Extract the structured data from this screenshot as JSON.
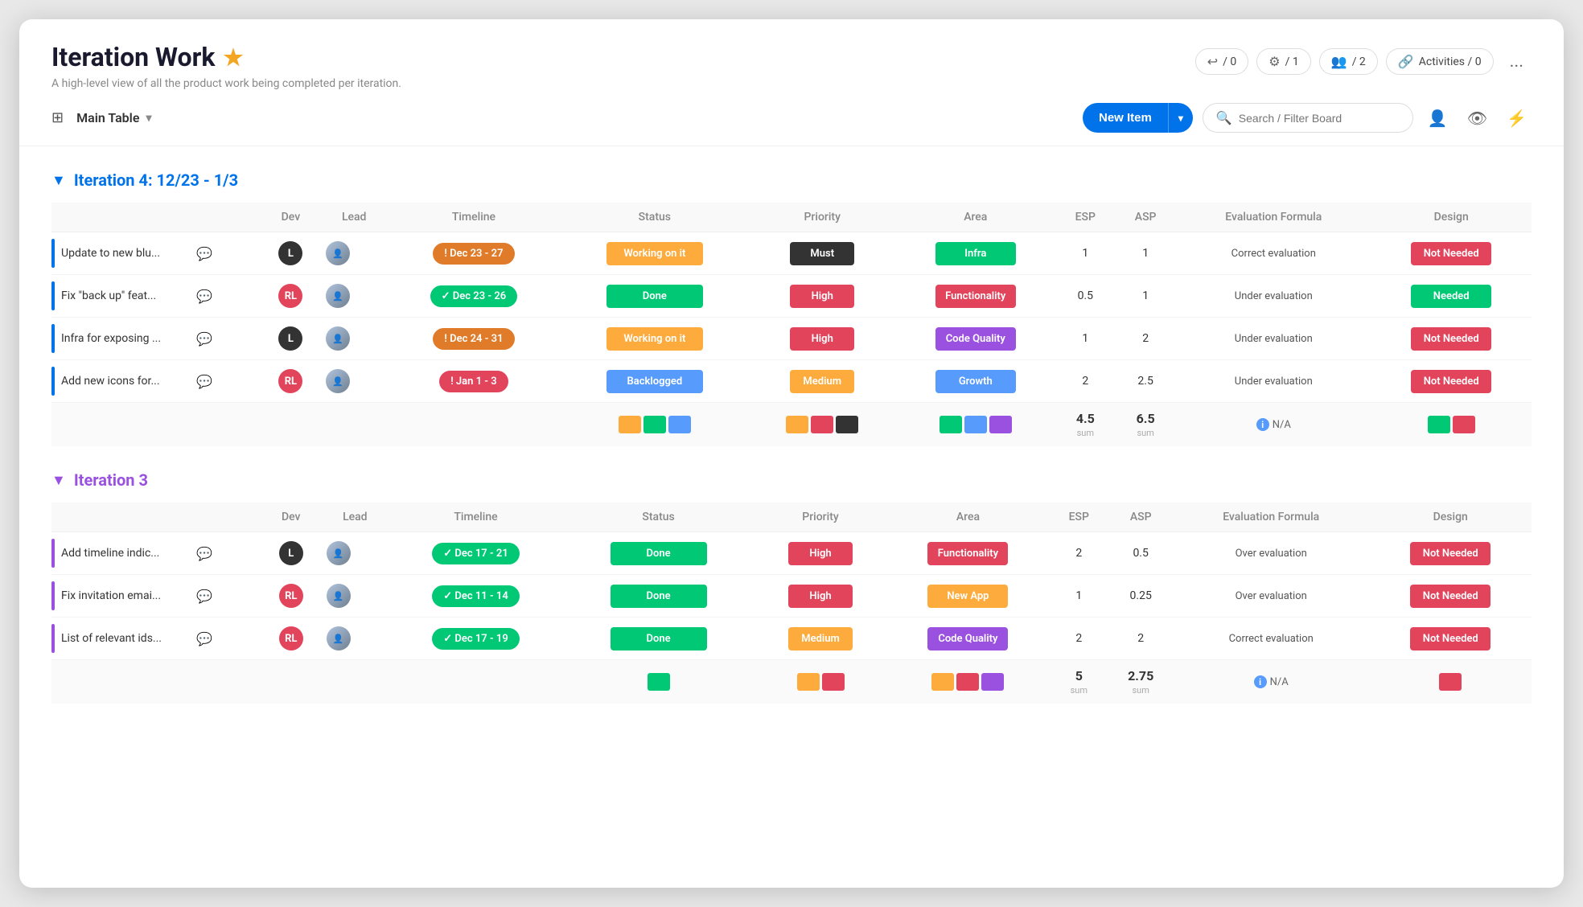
{
  "header": {
    "title": "Iteration Work",
    "subtitle": "A high-level view of all the product work being completed per iteration.",
    "badges": [
      {
        "icon": "🔁",
        "count": "/ 0"
      },
      {
        "icon": "🔗",
        "count": "/ 1"
      },
      {
        "icon": "👥",
        "count": "/ 2"
      }
    ],
    "activities": "Activities / 0",
    "more": "..."
  },
  "toolbar": {
    "main_table": "Main Table",
    "new_item": "New Item",
    "search_placeholder": "Search / Filter Board"
  },
  "iteration4": {
    "title": "Iteration 4: 12/23 - 1/3",
    "columns": [
      "Dev",
      "Lead",
      "Timeline",
      "Status",
      "Priority",
      "Area",
      "ESP",
      "ASP",
      "Evaluation Formula",
      "Design"
    ],
    "rows": [
      {
        "name": "Update to new blu...",
        "bar_color": "#0073ea",
        "dev_label": "L",
        "dev_bg": "#333",
        "timeline": "! Dec 23 - 27",
        "timeline_class": "timeline-orange",
        "status": "Working on it",
        "status_class": "status-working",
        "priority": "Must",
        "priority_class": "priority-must",
        "area": "Infra",
        "area_class": "area-infra",
        "esp": "1",
        "asp": "1",
        "eval": "Correct evaluation",
        "design": "Not Needed",
        "design_class": "design-not-needed"
      },
      {
        "name": "Fix \"back up\" feat...",
        "bar_color": "#0073ea",
        "dev_label": "RL",
        "dev_bg": "#e2445c",
        "timeline": "✓ Dec 23 - 26",
        "timeline_class": "timeline-green",
        "status": "Done",
        "status_class": "status-done",
        "priority": "High",
        "priority_class": "priority-high",
        "area": "Functionality",
        "area_class": "area-functionality",
        "esp": "0.5",
        "asp": "1",
        "eval": "Under evaluation",
        "design": "Needed",
        "design_class": "design-needed"
      },
      {
        "name": "Infra for exposing ...",
        "bar_color": "#0073ea",
        "dev_label": "L",
        "dev_bg": "#333",
        "timeline": "! Dec 24 - 31",
        "timeline_class": "timeline-orange",
        "status": "Working on it",
        "status_class": "status-working",
        "priority": "High",
        "priority_class": "priority-high",
        "area": "Code Quality",
        "area_class": "area-code",
        "esp": "1",
        "asp": "2",
        "eval": "Under evaluation",
        "design": "Not Needed",
        "design_class": "design-not-needed"
      },
      {
        "name": "Add new icons for...",
        "bar_color": "#0073ea",
        "dev_label": "RL",
        "dev_bg": "#e2445c",
        "timeline": "! Jan 1 - 3",
        "timeline_class": "timeline-red",
        "status": "Backlogged",
        "status_class": "status-backlogged",
        "priority": "Medium",
        "priority_class": "priority-medium",
        "area": "Growth",
        "area_class": "area-growth",
        "esp": "2",
        "asp": "2.5",
        "eval": "Under evaluation",
        "design": "Not Needed",
        "design_class": "design-not-needed"
      }
    ],
    "sum": {
      "esp": "4.5",
      "asp": "6.5",
      "status_chips": [
        "#fdab3d",
        "#00c875",
        "#579bfc"
      ],
      "priority_chips": [
        "#fdab3d",
        "#e2445c",
        "#333"
      ],
      "area_chips": [
        "#00c875",
        "#579bfc",
        "#9b51e0"
      ],
      "design_chips": [
        "#00c875",
        "#e2445c"
      ]
    }
  },
  "iteration3": {
    "title": "Iteration 3",
    "columns": [
      "Dev",
      "Lead",
      "Timeline",
      "Status",
      "Priority",
      "Area",
      "ESP",
      "ASP",
      "Evaluation Formula",
      "Design"
    ],
    "rows": [
      {
        "name": "Add timeline indic...",
        "bar_color": "#9b51e0",
        "dev_label": "L",
        "dev_bg": "#333",
        "timeline": "✓ Dec 17 - 21",
        "timeline_class": "timeline-green",
        "status": "Done",
        "status_class": "status-done",
        "priority": "High",
        "priority_class": "priority-high",
        "area": "Functionality",
        "area_class": "area-functionality",
        "esp": "2",
        "asp": "0.5",
        "eval": "Over evaluation",
        "design": "Not Needed",
        "design_class": "design-not-needed"
      },
      {
        "name": "Fix invitation emai...",
        "bar_color": "#9b51e0",
        "dev_label": "RL",
        "dev_bg": "#e2445c",
        "timeline": "✓ Dec 11 - 14",
        "timeline_class": "timeline-green",
        "status": "Done",
        "status_class": "status-done",
        "priority": "High",
        "priority_class": "priority-high",
        "area": "New App",
        "area_class": "area-newapp",
        "esp": "1",
        "asp": "0.25",
        "eval": "Over evaluation",
        "design": "Not Needed",
        "design_class": "design-not-needed"
      },
      {
        "name": "List of relevant ids...",
        "bar_color": "#9b51e0",
        "dev_label": "RL",
        "dev_bg": "#e2445c",
        "timeline": "✓ Dec 17 - 19",
        "timeline_class": "timeline-green",
        "status": "Done",
        "status_class": "status-done",
        "priority": "Medium",
        "priority_class": "priority-medium",
        "area": "Code Quality",
        "area_class": "area-code",
        "esp": "2",
        "asp": "2",
        "eval": "Correct evaluation",
        "design": "Not Needed",
        "design_class": "design-not-needed"
      }
    ],
    "sum": {
      "esp": "5",
      "asp": "2.75",
      "status_chips": [
        "#00c875"
      ],
      "priority_chips": [
        "#fdab3d",
        "#e2445c"
      ],
      "area_chips": [
        "#fdab3d",
        "#e2445c",
        "#9b51e0"
      ],
      "design_chips": [
        "#e2445c"
      ]
    }
  }
}
